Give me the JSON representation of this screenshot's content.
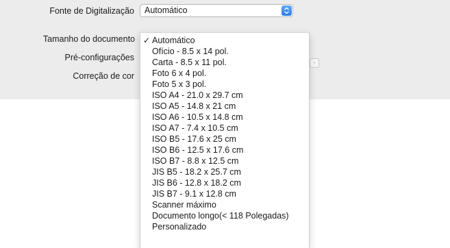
{
  "form": {
    "fonte_label": "Fonte de Digitalização",
    "tamanho_label": "Tamanho do documento",
    "pre_label": "Pré-configurações",
    "correcao_label": "Correção de cor",
    "fonte_value": "Automático",
    "behind_button": "-"
  },
  "menu": {
    "checkmark": "✓",
    "items": [
      "Automático",
      "Ofício - 8.5 x 14 pol.",
      "Carta - 8.5 x 11 pol.",
      "Foto 6 x 4 pol.",
      "Foto 5 x 3 pol.",
      "ISO A4 - 21.0 x 29.7 cm",
      "ISO A5 - 14.8 x 21 cm",
      "ISO A6 - 10.5 x 14.8 cm",
      "ISO A7 - 7.4 x 10.5 cm",
      "ISO B5 - 17.6 x 25 cm",
      "ISO B6 - 12.5 x 17.6 cm",
      "ISO B7 - 8.8 x 12.5 cm",
      "JIS B5 - 18.2 x 25.7 cm",
      "JIS B6 - 12.8 x 18.2 cm",
      "JIS B7 - 9.1 x 12.8 cm",
      "Scanner máximo",
      "Documento longo(< 118 Polegadas)",
      "Personalizado"
    ]
  },
  "colors": {
    "panel_bg": "#ececec",
    "accent": "#2c7ce8"
  }
}
